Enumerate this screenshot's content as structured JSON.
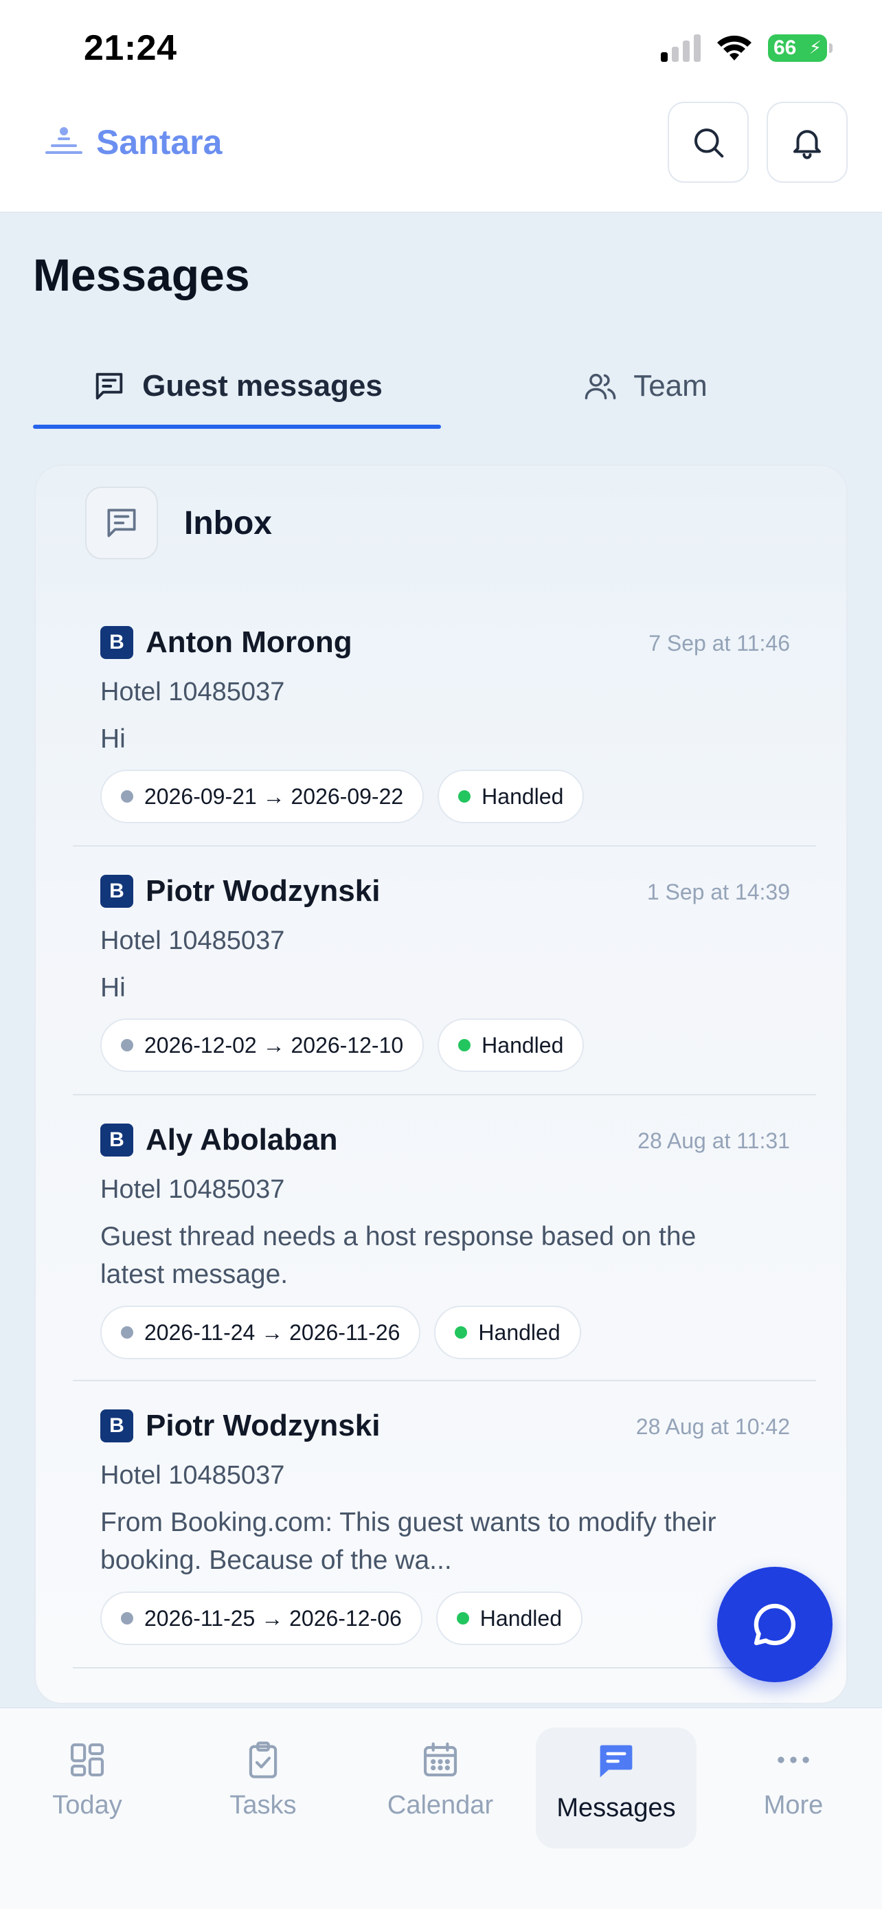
{
  "status_bar": {
    "time": "21:24",
    "battery": "66"
  },
  "header": {
    "brand": "Santara",
    "search_icon": "search-icon",
    "bell_icon": "bell-icon"
  },
  "page": {
    "title": "Messages"
  },
  "tabs": [
    {
      "label": "Guest messages",
      "icon": "message-square-icon",
      "active": true
    },
    {
      "label": "Team",
      "icon": "users-icon",
      "active": false
    }
  ],
  "inbox": {
    "title": "Inbox",
    "messages": [
      {
        "source": "B",
        "name": "Anton Morong",
        "time": "7 Sep at 11:46",
        "hotel": "Hotel 10485037",
        "text": "Hi",
        "dates": "2026-09-21 → 2026-09-22",
        "status": "Handled"
      },
      {
        "source": "B",
        "name": "Piotr Wodzynski",
        "time": "1 Sep at 14:39",
        "hotel": "Hotel 10485037",
        "text": "Hi",
        "dates": "2026-12-02 → 2026-12-10",
        "status": "Handled"
      },
      {
        "source": "B",
        "name": "Aly Abolaban",
        "time": "28 Aug at 11:31",
        "hotel": "Hotel 10485037",
        "text": "Guest thread needs a host response based on the latest message.",
        "dates": "2026-11-24 → 2026-11-26",
        "status": "Handled"
      },
      {
        "source": "B",
        "name": "Piotr Wodzynski",
        "time": "28 Aug at 10:42",
        "hotel": "Hotel 10485037",
        "text": "From Booking.com: This guest wants to modify their booking. Because of the wa...",
        "dates": "2026-11-25 → 2026-12-06",
        "status": "Handled"
      }
    ]
  },
  "bottom_nav": [
    {
      "label": "Today",
      "icon": "grid-icon"
    },
    {
      "label": "Tasks",
      "icon": "clipboard-icon"
    },
    {
      "label": "Calendar",
      "icon": "calendar-icon"
    },
    {
      "label": "Messages",
      "icon": "message-square-icon",
      "active": true
    },
    {
      "label": "More",
      "icon": "more-icon"
    }
  ],
  "colors": {
    "accent": "#2563eb",
    "fab": "#1f3fe0",
    "brand": "#6b8ff0",
    "handled": "#22c55e",
    "booking_badge": "#12367a"
  }
}
